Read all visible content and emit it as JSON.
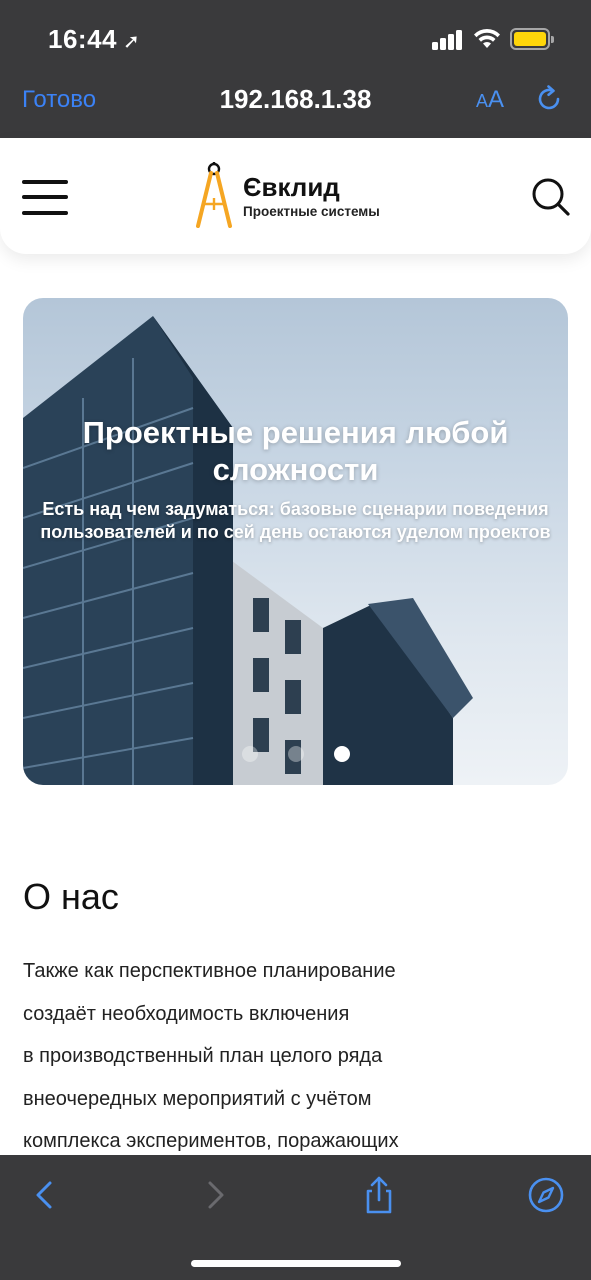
{
  "status_bar": {
    "time": "16:44",
    "location_glyph": "➚"
  },
  "browser": {
    "done_label": "Готово",
    "url": "192.168.1.38",
    "text_size_label_small": "A",
    "text_size_label_large": "A",
    "accent_color": "#3b82f6"
  },
  "header": {
    "logo_title": "Євклид",
    "logo_subtitle": "Проектные системы",
    "logo_color": "#f5a623"
  },
  "hero": {
    "title": "Проектные решения любой сложности",
    "text": "Есть над чем задуматься: базовые сценарии поведения пользователей и по сей день остаются уделом проектов",
    "slides_count": 3,
    "active_slide": 3
  },
  "about": {
    "title": "О нас",
    "lines": [
      "Также как перспективное планирование",
      "создаёт необходимость включения",
      "в производственный план целого ряда",
      "внеочередных мероприятий с учётом",
      "комплекса экспериментов, поражающих"
    ]
  }
}
